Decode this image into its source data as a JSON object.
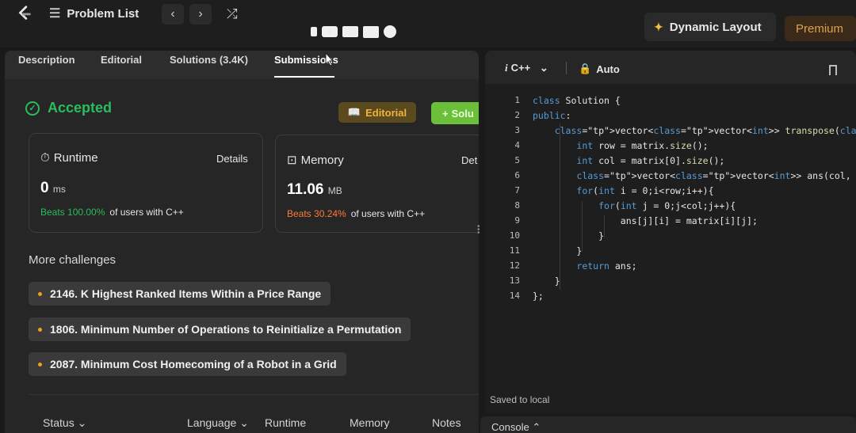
{
  "topbar": {
    "problem_list": "Problem List",
    "dynamic_layout": "Dynamic Layout",
    "premium": "Premium"
  },
  "tabs": {
    "description": "Description",
    "editorial": "Editorial",
    "solutions": "Solutions (3.4K)",
    "submissions": "Submissions"
  },
  "result": {
    "status": "Accepted",
    "editorial_btn": "Editorial",
    "solution_btn": "Solu"
  },
  "runtime": {
    "title": "Runtime",
    "details": "Details",
    "value": "0",
    "unit": "ms",
    "beats": "Beats 100.00%",
    "beats_rest": "of users with C++"
  },
  "memory": {
    "title": "Memory",
    "details": "Det",
    "value": "11.06",
    "unit": "MB",
    "beats": "Beats 30.24%",
    "beats_rest": "of users with C++"
  },
  "more_challenges": {
    "title": "More challenges",
    "items": [
      "2146. K Highest Ranked Items Within a Price Range",
      "1806. Minimum Number of Operations to Reinitialize a Permutation",
      "2087. Minimum Cost Homecoming of a Robot in a Grid"
    ]
  },
  "table_headers": {
    "status": "Status",
    "language": "Language",
    "runtime": "Runtime",
    "memory": "Memory",
    "notes": "Notes"
  },
  "editor": {
    "language": "C++",
    "mode": "Auto",
    "saved": "Saved to local",
    "console": "Console"
  },
  "code_lines": [
    "class Solution {",
    "public:",
    "    vector<vector<int>> transpose(vector<vector<int>>&",
    "        int row = matrix.size();",
    "        int col = matrix[0].size();",
    "        vector<vector<int>> ans(col, vector<int>(row,",
    "        for(int i = 0;i<row;i++){",
    "            for(int j = 0;j<col;j++){",
    "                ans[j][i] = matrix[i][j];",
    "            }",
    "        }",
    "        return ans;",
    "    }",
    "};"
  ],
  "colors": {
    "accent_green": "#2cbb5d",
    "beats_orange": "#ff7a3a",
    "editorial_gold": "#f0b43a",
    "premium": "#e0a04a"
  }
}
